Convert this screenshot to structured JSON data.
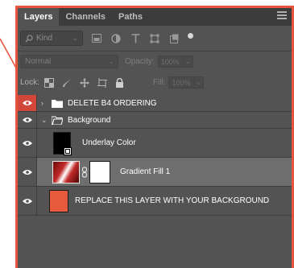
{
  "tabs": [
    {
      "label": "Layers",
      "active": true
    },
    {
      "label": "Channels",
      "active": false
    },
    {
      "label": "Paths",
      "active": false
    }
  ],
  "filter": {
    "kind_label": "Kind",
    "icons": [
      "image-filter-icon",
      "adjustment-filter-icon",
      "type-filter-icon",
      "shape-filter-icon",
      "smartobject-filter-icon",
      "filter-toggle-dot-icon"
    ]
  },
  "blend": {
    "mode": "Normal",
    "opacity_label": "Opacity:",
    "opacity_value": "100%"
  },
  "lock": {
    "label": "Lock:",
    "fill_label": "Fill:",
    "fill_value": "100%",
    "icons": [
      "lock-transparent-icon",
      "lock-paint-icon",
      "lock-move-icon",
      "lock-artboard-icon",
      "lock-all-icon"
    ]
  },
  "layers": [
    {
      "name": "DELETE B4 ORDERING",
      "type": "group",
      "expanded": false,
      "eye_highlight": true
    },
    {
      "name": "Background",
      "type": "group",
      "expanded": true,
      "eye_highlight": false
    },
    {
      "name": "Underlay Color",
      "type": "fill-layer",
      "eye_highlight": false
    },
    {
      "name": "Gradient Fill 1",
      "type": "gradient-fill",
      "selected": true,
      "eye_highlight": false
    },
    {
      "name": "REPLACE THIS LAYER WITH YOUR BACKGROUND",
      "type": "pixel",
      "eye_highlight": false
    }
  ],
  "colors": {
    "accent": "#e8553e",
    "panel_bg": "#535353",
    "eye_highlight": "#d3463a",
    "selected_row": "#6e6e6e",
    "background_thumb": "#e85a3c"
  }
}
